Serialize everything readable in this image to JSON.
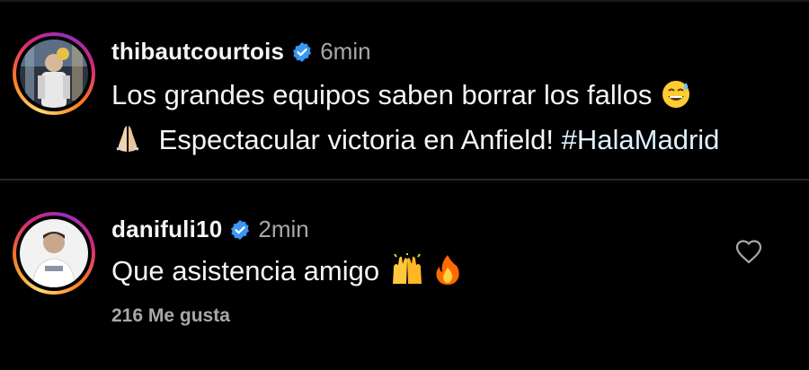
{
  "comments": [
    {
      "username": "thibautcourtois",
      "time": "6min",
      "line1": "Los grandes equipos saben borrar los fallos",
      "line2": "Espectacular victoria en Anfield!",
      "hashtag": "#HalaMadrid",
      "emojis": [
        "sweat-smile-emoji",
        "folded-hands-emoji"
      ]
    },
    {
      "username": "danifuli10",
      "time": "2min",
      "text": "Que asistencia amigo",
      "emojis": [
        "raising-hands-emoji",
        "fire-emoji"
      ]
    }
  ],
  "likes": "216 Me gusta",
  "colors": {
    "background": "#000000",
    "text": "#f5f5f5",
    "muted": "#a8a8a8",
    "verified": "#3897f0",
    "hashtag": "#e0f1ff"
  }
}
